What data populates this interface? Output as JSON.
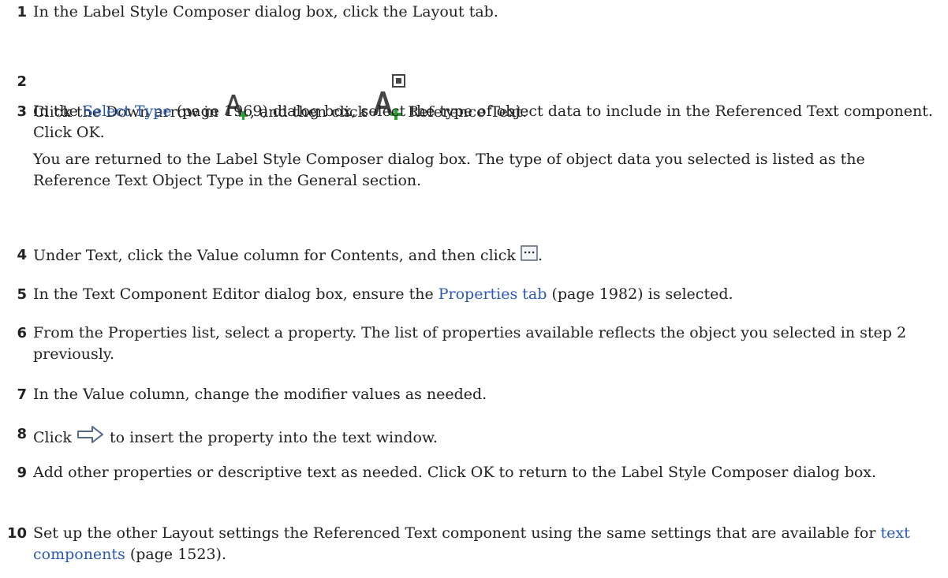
{
  "steps": [
    {
      "num": "1",
      "text": "In the Label Style Composer dialog box, click the Layout tab."
    },
    {
      "num": "2",
      "a": "Click the Down arrow in",
      "b": ", and then click",
      "c": "Reference Text.",
      "icons": [
        "add-text-component-icon",
        "reference-text-icon"
      ]
    },
    {
      "num": "3",
      "a": "In the",
      "link": "Select Type",
      "b": "(page 1969) dialog box, select the type of object data to include in the Referenced Text component. Click OK.",
      "note": "You are returned to the Label Style Composer dialog box. The type of object data you selected is listed as the Reference Text Object Type in the General section."
    },
    {
      "num": "4",
      "a": "Under Text, click the Value column for Contents, and then click",
      "b": ".",
      "icons": [
        "ellipsis-button-icon"
      ]
    },
    {
      "num": "5",
      "a": "In the Text Component Editor dialog box, ensure the",
      "link": "Properties tab",
      "b": "(page 1982) is selected."
    },
    {
      "num": "6",
      "text": "From the Properties list, select a property. The list of properties available reflects the object you selected in step 2 previously."
    },
    {
      "num": "7",
      "text": "In the Value column, change the modifier values as needed."
    },
    {
      "num": "8",
      "a": "Click",
      "b": "to insert the property into the text window.",
      "icons": [
        "insert-arrow-icon"
      ]
    },
    {
      "num": "9",
      "text": "Add other properties or descriptive text as needed. Click OK to return to the Label Style Composer dialog box."
    },
    {
      "num": "10",
      "a": "Set up the other Layout settings the Referenced Text component using the same settings that are available for",
      "link": "text components",
      "b": "(page 1523)."
    }
  ],
  "colors": {
    "link": "#2a5ab8",
    "plus": "#2e9e2e"
  }
}
